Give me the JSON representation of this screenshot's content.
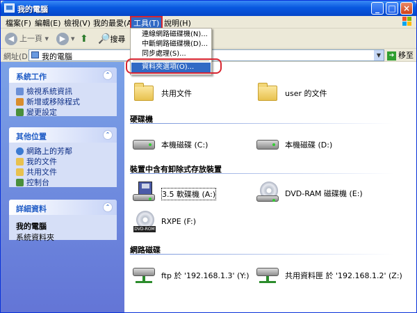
{
  "window": {
    "title": "我的電腦"
  },
  "menubar": {
    "items": [
      "檔案(F)",
      "編輯(E)",
      "檢視(V)",
      "我的最愛(A)",
      "工具(T)",
      "說明(H)"
    ]
  },
  "toolbar": {
    "back": "上一頁",
    "search": "搜尋"
  },
  "address": {
    "label": "網址(D)",
    "value": "我的電腦",
    "go": "移至"
  },
  "tools_menu": {
    "items": [
      "連線網路磁碟機(N)...",
      "中斷網路磁碟機(D)...",
      "同步處理(S)...",
      "資料夾選項(O)..."
    ]
  },
  "sidebar": {
    "system_tasks": {
      "title": "系統工作",
      "items": [
        "檢視系統資訊",
        "新增或移除程式",
        "變更設定"
      ]
    },
    "other_places": {
      "title": "其他位置",
      "items": [
        "網路上的芳鄰",
        "我的文件",
        "共用文件",
        "控制台"
      ]
    },
    "details": {
      "title": "詳細資料",
      "name": "我的電腦",
      "desc": "系統資料夾"
    }
  },
  "main": {
    "folders": [
      "共用文件",
      "user 的文件"
    ],
    "hard_drives_title": "硬碟機",
    "hard_drives": [
      "本機磁碟 (C:)",
      "本機磁碟 (D:)"
    ],
    "removable_title": "裝置中含有卸除式存放裝置",
    "removable": [
      "3.5 軟碟機 (A:)",
      "DVD-RAM 磁碟機 (E:)",
      "RXPE (F:)"
    ],
    "dvd_tag": "DVD-ROM",
    "network_title": "網路磁碟",
    "network": [
      "ftp 於 '192.168.1.3' (Y:)",
      "共用資料匣 於 '192.168.1.2' (Z:)"
    ]
  }
}
